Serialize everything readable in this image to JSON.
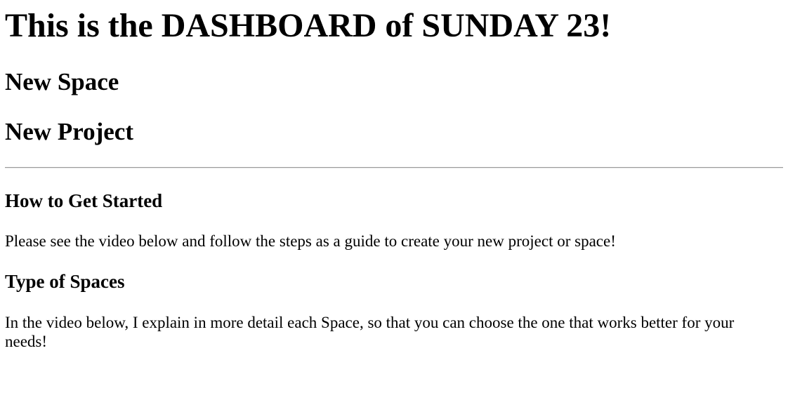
{
  "page": {
    "title": "This is the DASHBOARD of SUNDAY 23!"
  },
  "links": {
    "new_space": "New Space",
    "new_project": "New Project"
  },
  "sections": {
    "get_started": {
      "heading": "How to Get Started",
      "text": "Please see the video below and follow the steps as a guide to create your new project or space!"
    },
    "spaces": {
      "heading": "Type of Spaces",
      "text": "In the video below, I explain in more detail each Space, so that you can choose the one that works better for your needs!"
    }
  }
}
